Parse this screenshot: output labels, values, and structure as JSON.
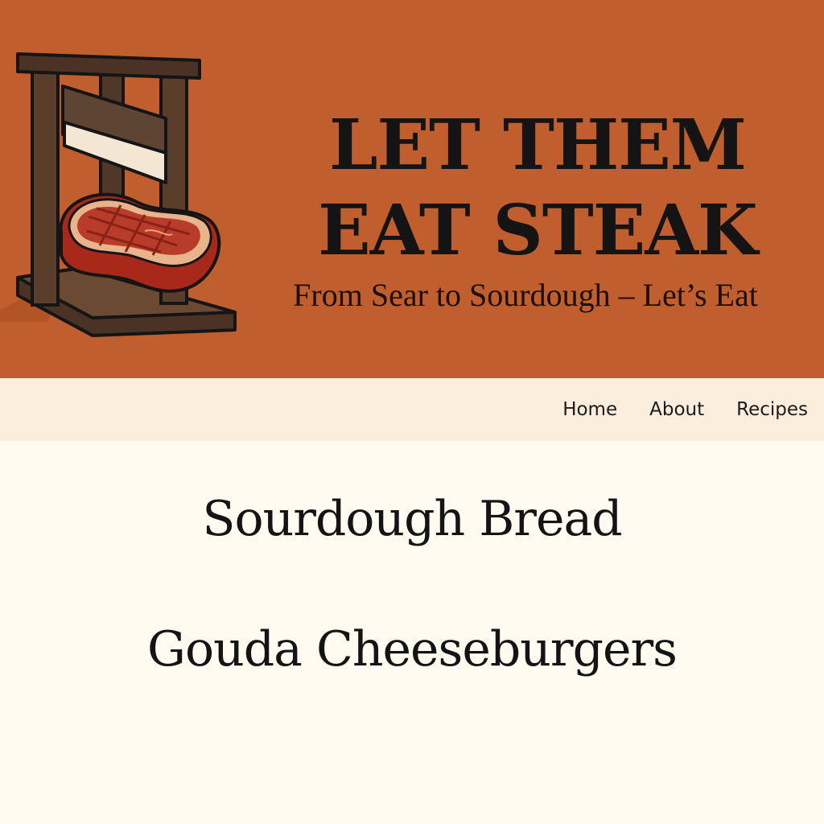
{
  "header": {
    "title": "LET THEM EAT STEAK",
    "tagline": "From Sear to Sourdough – Let’s Eat",
    "logo_icon": "guillotine-steak-icon",
    "colors": {
      "background": "#c05e2d",
      "text": "#141414"
    }
  },
  "nav": {
    "items": [
      {
        "label": "Home"
      },
      {
        "label": "About"
      },
      {
        "label": "Recipes"
      }
    ],
    "background": "#fbeedd"
  },
  "recipes": {
    "items": [
      {
        "label": "Sourdough Bread"
      },
      {
        "label": "Gouda Cheeseburgers"
      }
    ]
  },
  "page": {
    "background": "#fffbf0"
  }
}
